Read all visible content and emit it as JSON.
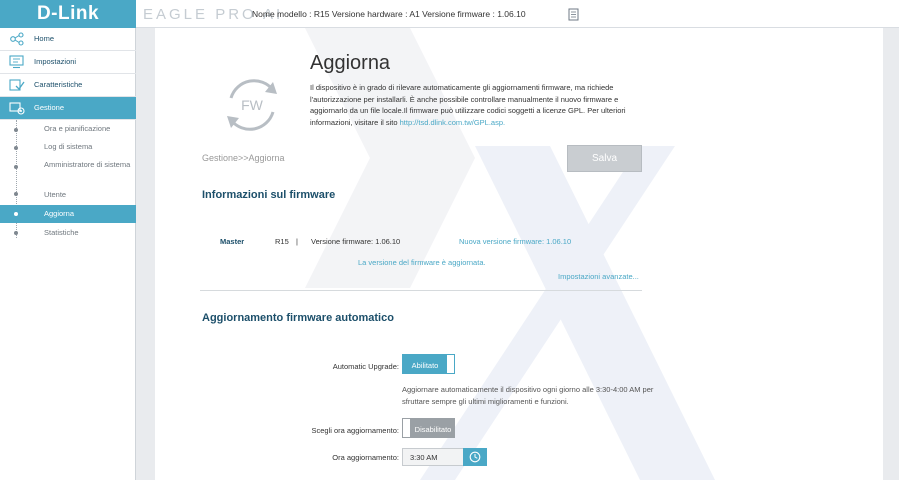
{
  "header": {
    "logo": "D-Link",
    "product": "EAGLE PRO AI",
    "model_info": "Nome modello : R15  Versione hardware : A1  Versione firmware : 1.06.10"
  },
  "sidebar": {
    "items": [
      {
        "label": "Home",
        "icon": "home-network-icon"
      },
      {
        "label": "Impostazioni",
        "icon": "settings-monitor-icon"
      },
      {
        "label": "Caratteristiche",
        "icon": "features-check-icon"
      },
      {
        "label": "Gestione",
        "icon": "management-gear-icon"
      }
    ],
    "subitems": [
      {
        "label": "Ora e pianificazione"
      },
      {
        "label": "Log di sistema"
      },
      {
        "label": "Amministratore di sistema"
      },
      {
        "label": "Utente"
      },
      {
        "label": "Aggiorna"
      },
      {
        "label": "Statistiche"
      }
    ]
  },
  "main": {
    "fw_logo_text": "FW",
    "title": "Aggiorna",
    "description": "Il dispositivo è in grado di rilevare automaticamente gli aggiornamenti firmware, ma richiede l'autorizzazione per installarli. È anche possibile controllare manualmente il nuovo firmware e aggiornarlo da un file locale.Il firmware può utilizzare codici soggetti a licenze GPL. Per ulteriori informazioni, visitare il sito",
    "gpl_link": "http://tsd.dlink.com.tw/GPL.asp.",
    "breadcrumb": "Gestione>>Aggiorna",
    "save_label": "Salva",
    "fw_section_title": "Informazioni sul firmware",
    "fw_row": {
      "role": "Master",
      "model": "R15",
      "separator": "|",
      "current": "Versione firmware: 1.06.10",
      "new": "Nuova versione firmware: 1.06.10"
    },
    "fw_status": "La versione del firmware è aggiornata.",
    "advanced_link": "Impostazioni avanzate...",
    "auto_section_title": "Aggiornamento firmware automatico",
    "auto_upgrade_label": "Automatic Upgrade:",
    "auto_upgrade_state": "Abilitato",
    "auto_upgrade_desc": "Aggiornare automaticamente il dispositivo ogni giorno alle 3:30-4:00 AM per sfruttare sempre gli ultimi miglioramenti e funzioni.",
    "choose_time_label": "Scegli ora aggiornamento:",
    "choose_time_state": "Disabilitato",
    "upgrade_time_label": "Ora aggiornamento:",
    "upgrade_time_value": "3:30 AM"
  },
  "colors": {
    "brand": "#4aa8c6",
    "title_dark": "#1c4f6a",
    "disabled": "#9aa0a5"
  }
}
